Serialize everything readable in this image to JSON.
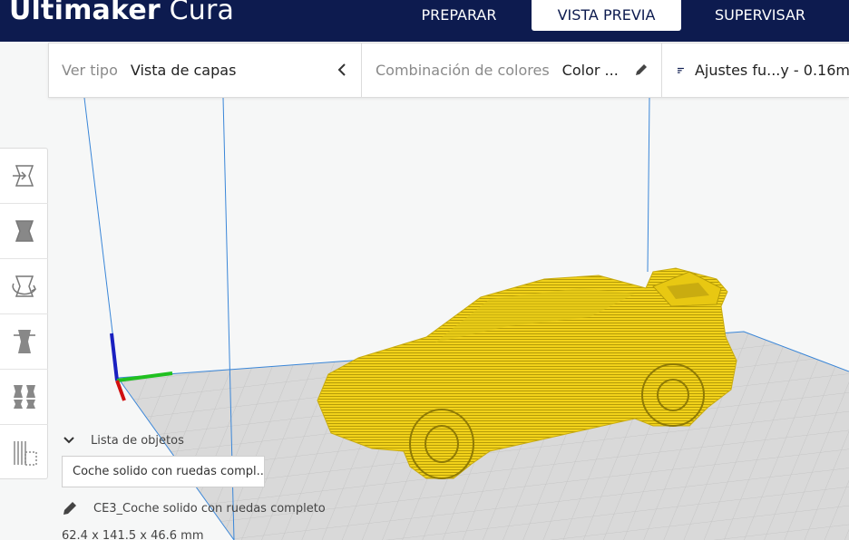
{
  "app": {
    "brand_bold": "Ultimaker",
    "brand_light": "Cura"
  },
  "tabs": [
    {
      "label": "PREPARAR",
      "active": false
    },
    {
      "label": "VISTA PREVIA",
      "active": true
    },
    {
      "label": "SUPERVISAR",
      "active": false
    }
  ],
  "toolbar": {
    "view_type_label": "Ver tipo",
    "view_type_value": "Vista de capas",
    "color_scheme_label": "Combinación de colores",
    "color_scheme_value": "Color ...",
    "print_settings": "Ajustes fu...y - 0.16m"
  },
  "tools": [
    {
      "icon": "move-icon"
    },
    {
      "icon": "scale-icon"
    },
    {
      "icon": "rotate-icon"
    },
    {
      "icon": "mirror-icon"
    },
    {
      "icon": "per-model-settings-icon"
    },
    {
      "icon": "support-blocker-icon"
    }
  ],
  "object_list": {
    "header": "Lista de objetos",
    "selected": "Coche solido con ruedas compl..."
  },
  "object": {
    "name": "CE3_Coche solido con ruedas completo",
    "dimensions": "62.4 x 141.5 x 46.6 mm"
  },
  "colors": {
    "header_bg": "#0d1b4f",
    "model_yellow": "#f2d21a",
    "axis_x": "#d01010",
    "axis_y": "#20c020",
    "axis_z": "#1a20c0",
    "build_volume_lines": "#3a86d8"
  }
}
